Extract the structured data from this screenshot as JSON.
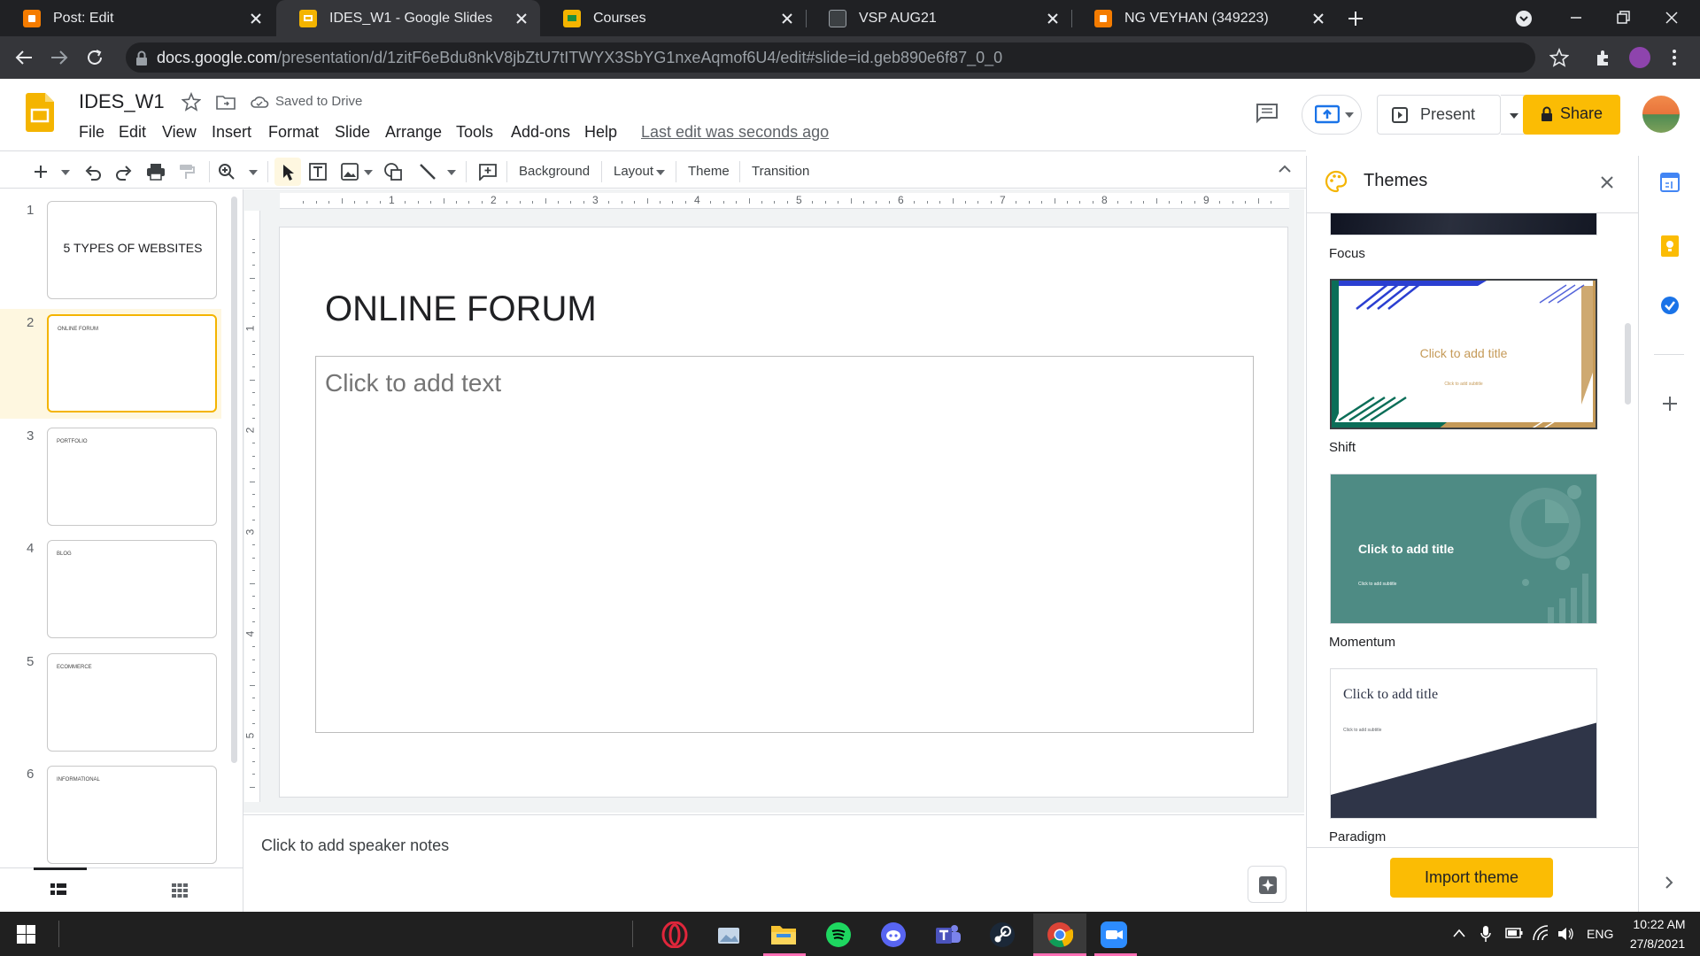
{
  "browser": {
    "tabs": [
      {
        "title": "Post: Edit",
        "favicon_color": "#f57c00"
      },
      {
        "title": "IDES_W1 - Google Slides",
        "favicon_color": "#f4b400",
        "active": true
      },
      {
        "title": "Courses",
        "favicon_color": "#f4b400"
      },
      {
        "title": "VSP AUG21",
        "favicon_color": "#9aa0a6"
      },
      {
        "title": "NG VEYHAN (349223)",
        "favicon_color": "#f57c00"
      }
    ],
    "url_host": "docs.google.com",
    "url_path": "/presentation/d/1zitF6eBdu8nkV8jbZtU7tITWYX3SbYG1nxeAqmof6U4/edit#slide=id.geb890e6f87_0_0"
  },
  "doc": {
    "title": "IDES_W1",
    "saved_status": "Saved to Drive",
    "menu": [
      "File",
      "Edit",
      "View",
      "Insert",
      "Format",
      "Slide",
      "Arrange",
      "Tools",
      "Add-ons",
      "Help"
    ],
    "last_edit": "Last edit was seconds ago",
    "present_label": "Present",
    "share_label": "Share"
  },
  "toolbar": {
    "background": "Background",
    "layout": "Layout",
    "theme": "Theme",
    "transition": "Transition"
  },
  "ruler": {
    "h": [
      "1",
      "2",
      "3",
      "4",
      "5",
      "6",
      "7",
      "8",
      "9"
    ],
    "v": [
      "1",
      "2",
      "3",
      "4",
      "5"
    ]
  },
  "slides": [
    {
      "num": "1",
      "title": "5 TYPES OF WEBSITES"
    },
    {
      "num": "2",
      "title": "ONLINE FORUM"
    },
    {
      "num": "3",
      "title": "PORTFOLIO"
    },
    {
      "num": "4",
      "title": "BLOG"
    },
    {
      "num": "5",
      "title": "ECOMMERCE"
    },
    {
      "num": "6",
      "title": "INFORMATIONAL"
    }
  ],
  "current_slide": {
    "title": "ONLINE FORUM",
    "body_placeholder": "Click to add text",
    "notes_placeholder": "Click to add speaker notes"
  },
  "themes_panel": {
    "title": "Themes",
    "themes": [
      {
        "name": "Focus"
      },
      {
        "name": "Shift",
        "title_ph": "Click to add title",
        "subtitle_ph": "Click to add subtitle"
      },
      {
        "name": "Momentum",
        "title_ph": "Click to add title",
        "subtitle_ph": "Click to add subtitle"
      },
      {
        "name": "Paradigm",
        "title_ph": "Click to add title",
        "subtitle_ph": "Click to add subtitle"
      }
    ],
    "import_label": "Import theme"
  },
  "taskbar": {
    "language": "ENG",
    "time": "10:22 AM",
    "date": "27/8/2021"
  },
  "colors": {
    "accent": "#fbbc04",
    "slides_yellow": "#f4b400",
    "momentum": "#4e8b84",
    "paradigm_dark": "#2f3548"
  }
}
